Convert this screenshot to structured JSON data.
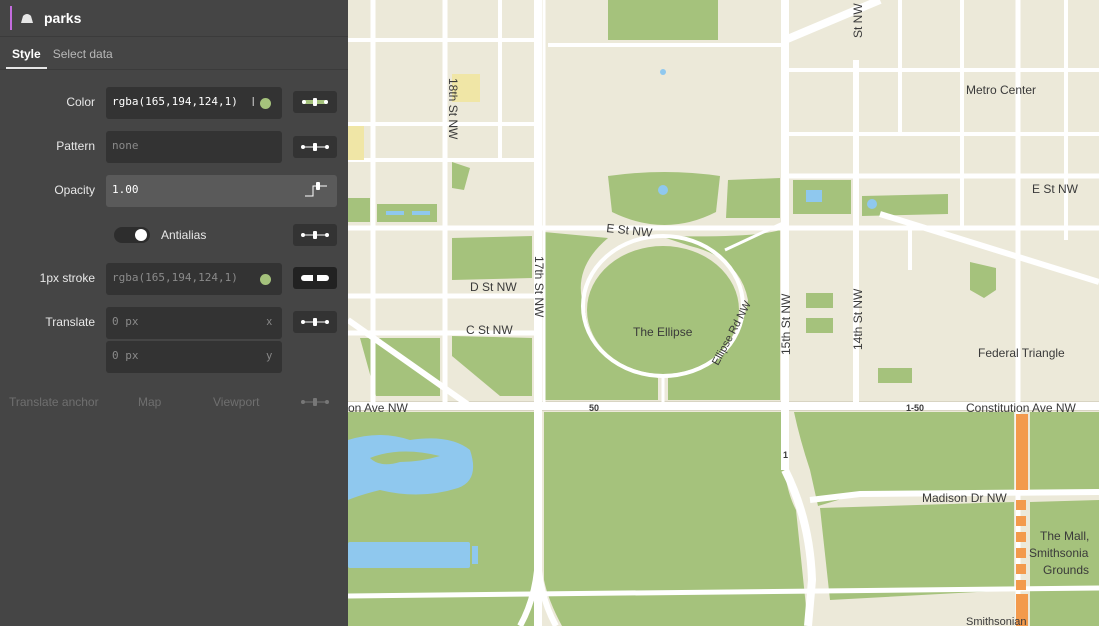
{
  "layer": {
    "name": "parks",
    "icon": "polygon-icon",
    "accent_color": "#c36cde"
  },
  "tabs": [
    {
      "label": "Style",
      "active": true
    },
    {
      "label": "Select data",
      "active": false
    }
  ],
  "style": {
    "color": {
      "label": "Color",
      "value": "rgba(165,194,124,1)",
      "swatch": "#a5c27c"
    },
    "pattern": {
      "label": "Pattern",
      "value": "none"
    },
    "opacity": {
      "label": "Opacity",
      "value": "1.00"
    },
    "antialias": {
      "label": "Antialias",
      "on": true
    },
    "stroke": {
      "label": "1px stroke",
      "value": "rgba(165,194,124,1)",
      "swatch": "#a5c27c"
    },
    "translate": {
      "label": "Translate",
      "x_value": "0",
      "x_unit": "px",
      "x_axis": "x",
      "y_value": "0",
      "y_unit": "px",
      "y_axis": "y"
    },
    "translate_anchor": {
      "label": "Translate anchor",
      "option_map": "Map",
      "option_viewport": "Viewport"
    }
  },
  "map": {
    "colors": {
      "land": "#ece9d9",
      "park": "#a5c27c",
      "water": "#8fc8ee",
      "road": "#ffffff",
      "road_casing": "#d8d4c2",
      "building": "#e4e0cf",
      "transit": "#f39a4c"
    },
    "labels": {
      "street_18th": "18th St NW",
      "street_17th": "17th St NW",
      "street_15th": "15th St NW",
      "street_14th": "14th St NW",
      "street_e_west": "E St NW",
      "street_e_east": "E St NW",
      "street_d": "D St NW",
      "street_c": "C St NW",
      "ellipse": "The Ellipse",
      "ellipse_rd": "Ellipse Rd NW",
      "metro_center": "Metro Center",
      "federal_triangle": "Federal Triangle",
      "constitution_left": "on Ave NW",
      "constitution_right": "Constitution Ave NW",
      "shield_50": "50",
      "shield_1_50": "1-50",
      "shield_1": "1",
      "madison": "Madison Dr NW",
      "mall_line1": "The Mall,",
      "mall_line2": "Smithsonia",
      "mall_line3": "Grounds",
      "smithsonian": "Smithsonian",
      "st_nw_top": "St NW"
    }
  }
}
